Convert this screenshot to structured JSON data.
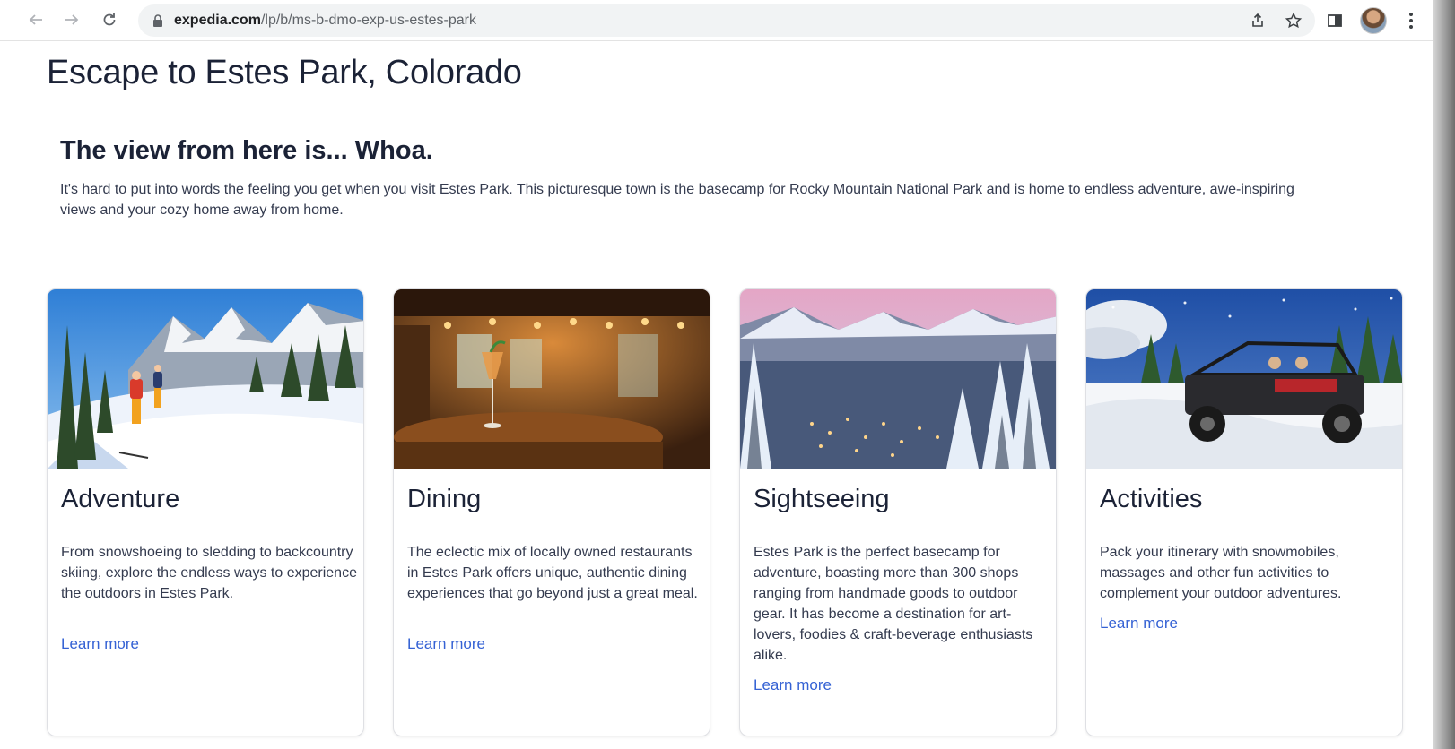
{
  "browser": {
    "url_domain": "expedia.com",
    "url_path": "/lp/b/ms-b-dmo-exp-us-estes-park",
    "icons": [
      "back-arrow-icon",
      "forward-arrow-icon",
      "reload-icon",
      "lock-icon",
      "share-icon",
      "star-icon",
      "side-panel-icon",
      "profile-avatar",
      "kebab-menu-icon"
    ]
  },
  "page": {
    "title": "Escape to Estes Park, Colorado",
    "section_heading": "The view from here is... Whoa.",
    "section_intro": "It's hard to put into words the feeling you get when you visit Estes Park. This picturesque town is the basecamp for Rocky Mountain National Park and is home to endless adventure, awe-inspiring views and your cozy home away from home."
  },
  "cards": [
    {
      "title": "Adventure",
      "description": "From snowshoeing to sledding to backcountry skiing, explore the endless ways to experience the outdoors in Estes Park.",
      "link": "Learn more",
      "image": "skiers-in-snowy-mountains"
    },
    {
      "title": "Dining",
      "description": "The eclectic mix of locally owned restaurants in Estes Park offers unique, authentic dining experiences that go beyond just a great meal.",
      "link": "Learn more",
      "image": "restaurant-interior-with-cocktail"
    },
    {
      "title": "Sightseeing",
      "description": "Estes Park is the perfect basecamp for adventure, boasting more than 300 shops ranging from handmade goods to outdoor gear. It has become a destination for art-lovers, foodies & craft-beverage enthusiasts alike.",
      "link": "Learn more",
      "image": "snowy-town-valley-view"
    },
    {
      "title": "Activities",
      "description": "Pack your itinerary with snowmobiles, massages and other fun activities to complement your outdoor adventures.",
      "link": "Learn more",
      "image": "off-road-vehicle-in-snow"
    }
  ],
  "colors": {
    "text_dark": "#1b2236",
    "link_blue": "#3562d4",
    "card_border": "#dfe0e4"
  }
}
